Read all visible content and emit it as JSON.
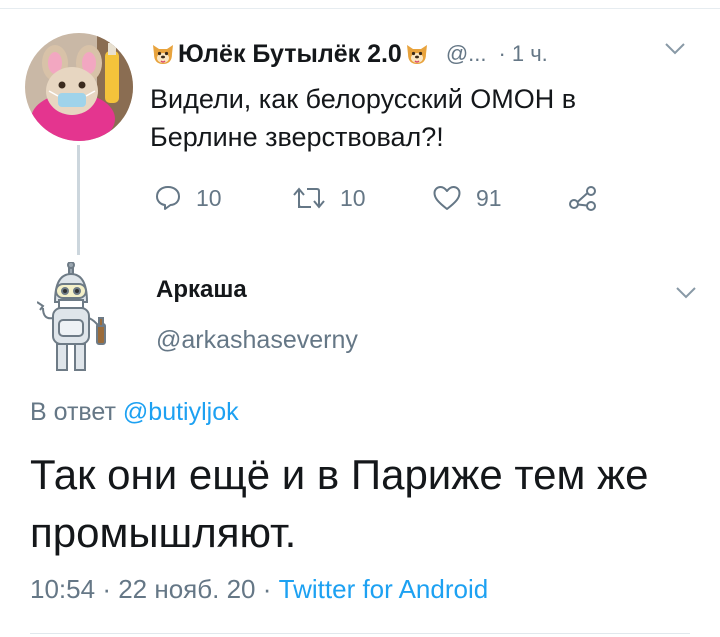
{
  "parent_tweet": {
    "name": "Юлёк Бутылёк 2.0",
    "handle": "@...",
    "separator": "·",
    "time": "1 ч.",
    "text": "Видели, как белорусский ОМОН в Берлине зверствовал?!",
    "actions": {
      "reply_count": "10",
      "retweet_count": "10",
      "like_count": "91"
    },
    "name_emoji": "dog-face-emoji-icon"
  },
  "reply_tweet": {
    "name": "Аркаша",
    "handle": "@arkashaseverny",
    "reply_prefix": "В ответ",
    "reply_mention": "@butiyljok",
    "text": "Так они ещё и в Париже тем же промышляют.",
    "time": "10:54",
    "date": "22 нояб. 20",
    "dot": "·",
    "client": "Twitter for Android"
  },
  "colors": {
    "text": "#14171a",
    "secondary": "#657786",
    "link": "#1da1f2",
    "divider": "#e6ecf0"
  }
}
